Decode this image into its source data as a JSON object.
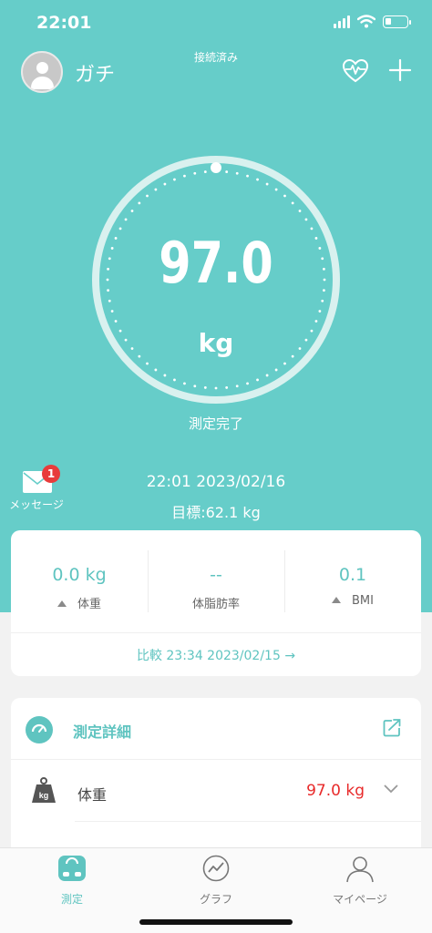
{
  "status_bar": {
    "time": "22:01",
    "battery_level": 0.25
  },
  "header": {
    "connection_status": "接続済み",
    "username": "ガチ",
    "avatar_icon": "user-avatar-icon",
    "heart_icon": "heart-monitor-icon",
    "add_icon": "plus-icon"
  },
  "gauge": {
    "value": "97.0",
    "unit": "kg",
    "status": "測定完了",
    "ring_color": "#d9f1ef"
  },
  "messages": {
    "label": "メッセージ",
    "badge_count": "1",
    "icon": "mail-icon"
  },
  "measurement": {
    "time": "22:01 2023/02/16",
    "target": "目標:62.1 kg"
  },
  "summary": {
    "stats": [
      {
        "value": "0.0 kg",
        "label": "体重",
        "trend": "up"
      },
      {
        "value": "--",
        "label": "体脂肪率",
        "trend": "none"
      },
      {
        "value": "0.1",
        "label": "BMI",
        "trend": "up"
      }
    ],
    "compare": "比較 23:34 2023/02/15 →"
  },
  "detail": {
    "title": "測定詳細",
    "rows": [
      {
        "label": "体重",
        "value": "97.0 kg",
        "icon": "weight-kg-icon"
      }
    ]
  },
  "tabs": [
    {
      "label": "測定",
      "icon": "scale-icon",
      "active": true
    },
    {
      "label": "グラフ",
      "icon": "graph-icon",
      "active": false
    },
    {
      "label": "マイページ",
      "icon": "profile-icon",
      "active": false
    }
  ],
  "colors": {
    "accent": "#66cdc9",
    "teal_text": "#5fc4c0",
    "highlight_value": "#e82a2a",
    "badge": "#e83b3b"
  }
}
